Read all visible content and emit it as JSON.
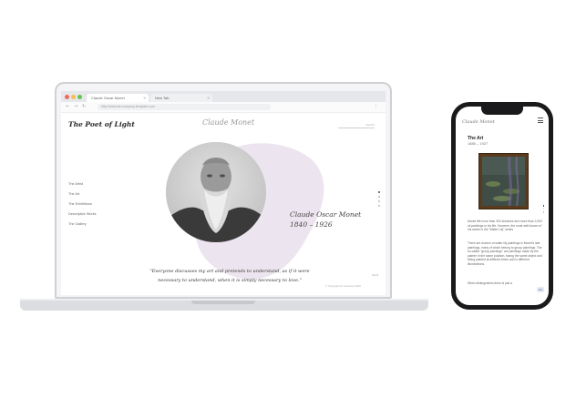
{
  "browser": {
    "tabs": [
      {
        "label": "Claude Oscar Monet",
        "close": "×"
      },
      {
        "label": "New Tab",
        "close": "×"
      }
    ],
    "url": "http://www.art-company-template.com"
  },
  "site": {
    "title": "The Poet of Light",
    "logo": "Claude Monet",
    "search_placeholder": "Search",
    "nav": [
      "The Artist",
      "The Art",
      "The Exhibitions",
      "Descriptive Works",
      "The Gallery"
    ],
    "artist_name": "Claude Oscar Monet",
    "artist_years": "1840 – 1926",
    "quote_line1": "\"Everyone discusses my art and pretends to understand, as if it were",
    "quote_line2": "necessary to understand, when it is simply necessary to love.\"",
    "scroll_label": "Scroll",
    "copyright": "© Copyright Art Company 2020"
  },
  "mobile": {
    "logo": "Claude Monet",
    "section_title": "The Art",
    "years": "1886 – 1927",
    "paragraphs": [
      "Monet left more than 300 sketches and more than 2,000 oil paintings in his life. However, the most well-known of his works is the \"Water Lily\" series.",
      "There are dozens of water lily paintings in Monet's late paintings, many of which belong to group paintings. The so-called \"group paintings\" are paintings made by the painter in the same position, facing the same object and being painted at different times and in different illuminations.",
      "When distinguishes them is just a"
    ],
    "badge": "EN"
  },
  "colors": {
    "blob": "#ece4ee",
    "phone_body": "#1a1a1c",
    "frame": "#5b3b1e"
  }
}
